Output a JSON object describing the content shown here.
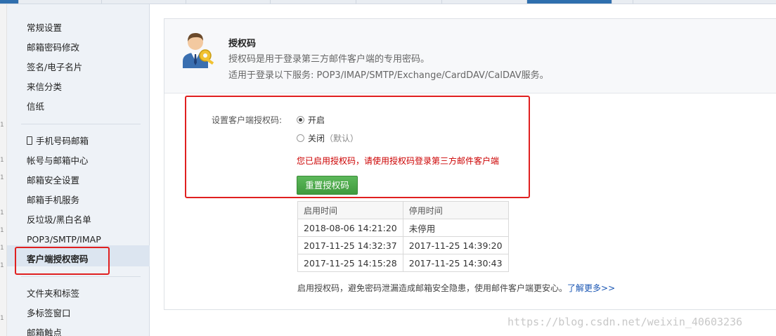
{
  "gutter_numbers": [
    "1",
    "1",
    "1",
    "1",
    "1",
    "1",
    "1",
    "1"
  ],
  "sidebar": {
    "group1": [
      "常规设置",
      "邮箱密码修改",
      "签名/电子名片",
      "来信分类",
      "信纸"
    ],
    "group2": [
      "手机号码邮箱",
      "帐号与邮箱中心",
      "邮箱安全设置",
      "邮箱手机服务",
      "反垃圾/黑白名单",
      "POP3/SMTP/IMAP",
      "客户端授权密码"
    ],
    "group3": [
      "文件夹和标签",
      "多标签窗口",
      "邮箱触点"
    ]
  },
  "header": {
    "title": "授权码",
    "desc1": "授权码是用于登录第三方邮件客户端的专用密码。",
    "desc2": "适用于登录以下服务: POP3/IMAP/SMTP/Exchange/CardDAV/CalDAV服务。"
  },
  "setting": {
    "label": "设置客户端授权码:",
    "option_on": "开启",
    "option_off": "关闭",
    "option_off_note": "（默认）",
    "selected": "开启",
    "warning": "您已启用授权码，请使用授权码登录第三方邮件客户端",
    "reset_button": "重置授权码"
  },
  "log_table": {
    "headers": [
      "启用时间",
      "停用时间"
    ],
    "rows": [
      [
        "2018-08-06 14:21:20",
        "未停用"
      ],
      [
        "2017-11-25 14:32:37",
        "2017-11-25 14:39:20"
      ],
      [
        "2017-11-25 14:15:28",
        "2017-11-25 14:30:43"
      ]
    ]
  },
  "footnote": {
    "text": "启用授权码，避免密码泄漏造成邮箱安全隐患，使用邮件客户端更安心。",
    "link": "了解更多>>"
  },
  "watermark": "https://blog.csdn.net/weixin_40603236",
  "icons": {
    "header_icon": "user-key-icon",
    "phone": "phone-icon"
  },
  "colors": {
    "accent": "#2f6fae",
    "button": "#4cae4a",
    "warning": "#cc0000",
    "highlight": "#e02020",
    "link": "#1a56b3"
  }
}
